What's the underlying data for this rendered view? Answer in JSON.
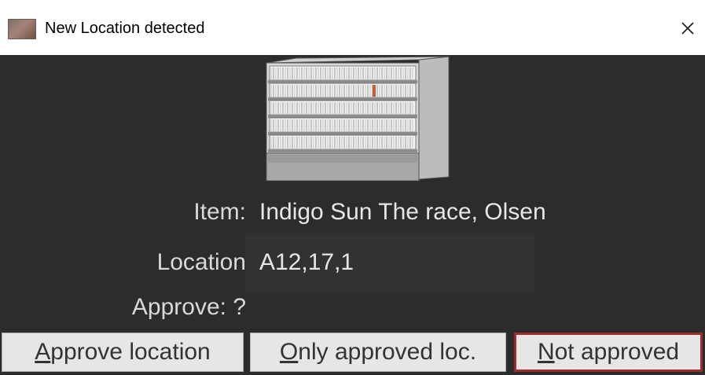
{
  "window": {
    "title": "New Location detected",
    "close_glyph": "✕",
    "icon": "app-icon"
  },
  "shelf_image": {
    "icon": "shelf-illustration",
    "highlight_color": "#c0603a"
  },
  "fields": {
    "item_label": "Item:",
    "item_value": "Indigo Sun The race, Olsen",
    "location_label": "Location",
    "location_value": "A12,17,1",
    "approve_label": "Approve: ?"
  },
  "buttons": {
    "approve_location": {
      "mnemonic": "A",
      "rest": "pprove location"
    },
    "only_approved": {
      "mnemonic": "O",
      "rest": "nly approved loc."
    },
    "not_approved": {
      "mnemonic": "N",
      "rest": "ot approved"
    }
  },
  "colors": {
    "background": "#2c2c2c",
    "text": "#e6e6e6",
    "focus_border": "#9c2d2d"
  }
}
